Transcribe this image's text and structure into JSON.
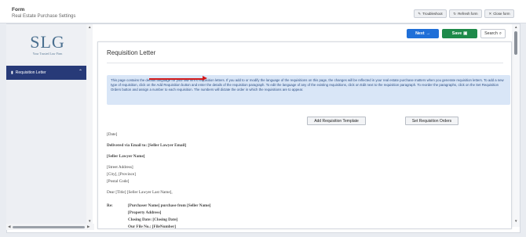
{
  "header": {
    "title": "Form",
    "subtitle": "Real Estate Purchase Settings",
    "buttons": {
      "troubleshoot": "Troubleshoot",
      "refresh": "Refresh form",
      "close": "Close form"
    }
  },
  "sidebar": {
    "logo_main": "SLG",
    "logo_tagline": "Your Trusted Law Firm",
    "items": [
      {
        "label": "Requisition Letter"
      }
    ]
  },
  "actions": {
    "next": "Next",
    "save": "Save",
    "search": "Search"
  },
  "document": {
    "title": "Requisition Letter",
    "info_text": "This page contains the default language for your law firm's requisition letters. If you add to or modify the language of the requisitions on this page, the changes will be reflected in your real estate purchase matters when you generate requisition letters. To add a new type of requisition, click on the Add Requisition button and enter the details of the requisition paragraph. To edit the language of any of the existing requisitions, click on Edit next to the requisition paragraph. To reorder the paragraphs, click on the Set Requisition Orders button and assign a number to each requisition. The numbers will dictate the order in which the requisitions are to appear.",
    "add_button": "Add Requisition Template",
    "set_button": "Set Requisition Orders",
    "letter": {
      "date": "[Date]",
      "delivered_via": "Delivered via Email to: [Seller Lawyer Email]",
      "seller_lawyer_name": "[Seller Lawyer Name]",
      "street": "[Street Address]",
      "city": "[City], [Province]",
      "postal": "[Postal Code]",
      "greeting": "Dear [Title] [Seller Lawyer Last Name],",
      "re_label": "Re:",
      "re_lines": [
        "[Purchaser Name] purchase from [Seller Name]",
        "[Property Address]",
        "Closing Date: [Closing Date]",
        "Our File No.: [FileNumber]"
      ]
    }
  },
  "colors": {
    "nav_active": "#273a78",
    "next": "#1f6fd8",
    "save": "#1e8a4a",
    "info_bg": "#d9e6f7",
    "arrow": "#d21a1a"
  }
}
